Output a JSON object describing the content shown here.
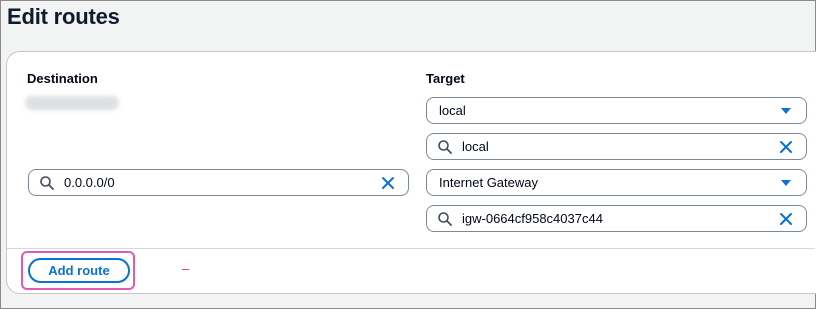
{
  "page": {
    "title": "Edit routes"
  },
  "columns": {
    "destination": "Destination",
    "target": "Target"
  },
  "routes": [
    {
      "destination_value": "",
      "target_type": "local",
      "target_id": "local"
    },
    {
      "destination_value": "0.0.0.0/0",
      "target_type": "Internet Gateway",
      "target_id": "igw-0664cf958c4037c44"
    }
  ],
  "actions": {
    "add_route_label": "Add route"
  },
  "icons": {
    "search": "search-icon",
    "clear": "close-icon",
    "dropdown": "caret-down-icon"
  },
  "colors": {
    "accent": "#0972d3",
    "highlight": "#e05ab8",
    "border": "#7d8998"
  }
}
